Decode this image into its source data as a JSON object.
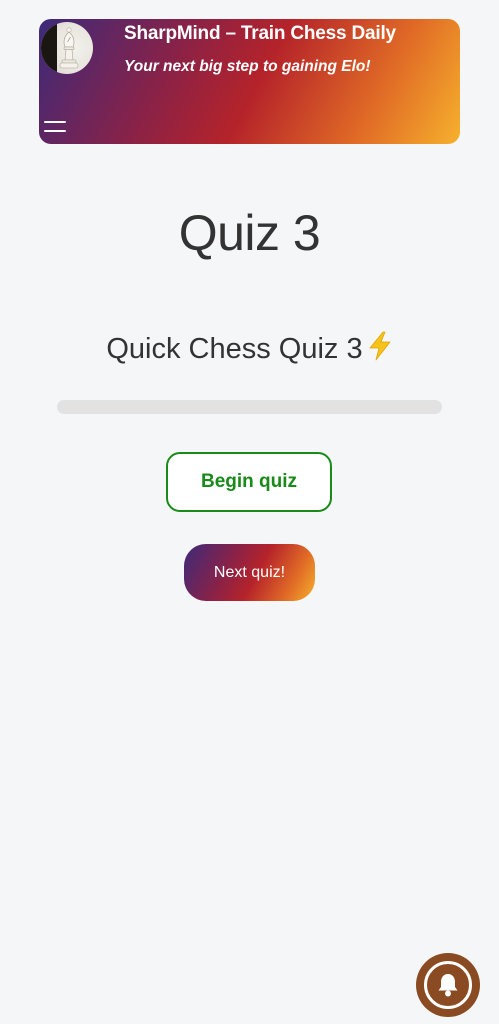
{
  "header": {
    "site_title": "SharpMind – Train Chess Daily",
    "tagline": "Your next big step to gaining Elo!",
    "logo_icon": "chess-bishop-icon",
    "menu_icon": "hamburger-menu-icon",
    "gradient_colors": [
      "#3c2a7a",
      "#b5232a",
      "#f6b12d"
    ]
  },
  "main": {
    "page_title": "Quiz 3",
    "quiz_subtitle": "Quick Chess Quiz 3",
    "subtitle_icon": "lightning-bolt-icon",
    "progress": 0,
    "begin_button_label": "Begin quiz",
    "next_button_label": "Next quiz!",
    "accent_green": "#1a8a1a"
  },
  "notification": {
    "icon": "bell-icon",
    "color": "#8a4a22"
  }
}
